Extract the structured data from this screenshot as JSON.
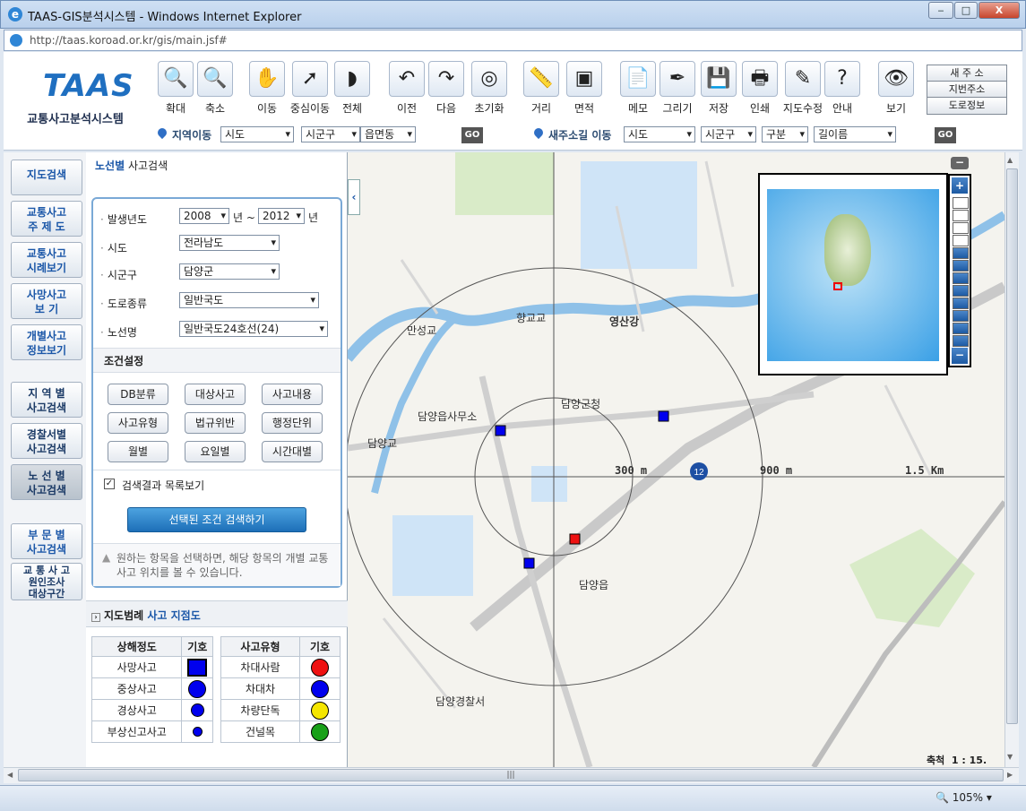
{
  "window": {
    "title": "TAAS-GIS분석시스템 - Windows Internet Explorer",
    "minimize": "‒",
    "maximize": "□",
    "close": "X"
  },
  "address": {
    "url": "http://taas.koroad.or.kr/gis/main.jsf#"
  },
  "logo": {
    "big": "TAAS",
    "sub": "교통사고분석시스템"
  },
  "toolbar": {
    "buttons": [
      {
        "label": "확대",
        "icon": "zoom-in-icon",
        "glyph": "🔍"
      },
      {
        "label": "축소",
        "icon": "zoom-out-icon",
        "glyph": "🔍"
      },
      {
        "label": "이동",
        "icon": "hand-icon",
        "glyph": "✋"
      },
      {
        "label": "중심이동",
        "icon": "center-move-icon",
        "glyph": "➚"
      },
      {
        "label": "전체",
        "icon": "full-extent-icon",
        "glyph": "◗"
      },
      {
        "label": "이전",
        "icon": "previous-icon",
        "glyph": "↶"
      },
      {
        "label": "다음",
        "icon": "next-icon",
        "glyph": "↷"
      },
      {
        "label": "초기화",
        "icon": "reset-icon",
        "glyph": "◎"
      },
      {
        "label": "거리",
        "icon": "ruler-icon",
        "glyph": "📏"
      },
      {
        "label": "면적",
        "icon": "area-icon",
        "glyph": "▣"
      },
      {
        "label": "메모",
        "icon": "memo-icon",
        "glyph": "📄"
      },
      {
        "label": "그리기",
        "icon": "pen-icon",
        "glyph": "✒"
      },
      {
        "label": "저장",
        "icon": "save-icon",
        "glyph": "💾"
      },
      {
        "label": "인쇄",
        "icon": "print-icon",
        "glyph": "🖶"
      },
      {
        "label": "지도수정",
        "icon": "edit-map-icon",
        "glyph": "✎"
      },
      {
        "label": "안내",
        "icon": "help-icon",
        "glyph": "?"
      },
      {
        "label": "보기",
        "icon": "eye-icon",
        "glyph": "👁"
      }
    ],
    "side": [
      "새 주 소",
      "지번주소",
      "도로정보"
    ],
    "region": {
      "label": "지역이동",
      "selects": [
        "시도",
        "시군구",
        "읍면동"
      ],
      "go": "GO"
    },
    "newaddr": {
      "label": "새주소길 이동",
      "selects": [
        "시도",
        "시군구",
        "구분",
        "길이름"
      ],
      "go": "GO"
    }
  },
  "nav": [
    {
      "label": "지도검색",
      "l2": ""
    },
    {
      "label": "교통사고",
      "l2": "주 제 도"
    },
    {
      "label": "교통사고",
      "l2": "시례보기"
    },
    {
      "label": "사망사고",
      "l2": "보    기"
    },
    {
      "label": "개별사고",
      "l2": "정보보기"
    },
    {
      "label": "지 역 별",
      "l2": "사고검색"
    },
    {
      "label": "경찰서별",
      "l2": "사고검색"
    },
    {
      "label": "노 선 별",
      "l2": "사고검색"
    },
    {
      "label": "부 문 별",
      "l2": "사고검색"
    },
    {
      "label": "교 통 사 고",
      "l2": "원인조사",
      "l3": "대상구간"
    }
  ],
  "panel": {
    "title_a": "노선별",
    "title_b": "사고검색",
    "year_label": "발생년도",
    "year_from": "2008",
    "year_sep": "년 ~",
    "year_to": "2012",
    "year_end": "년",
    "sido_label": "시도",
    "sido": "전라남도",
    "sigungu_label": "시군구",
    "sigungu": "담양군",
    "roadtype_label": "도로종류",
    "roadtype": "일반국도",
    "route_label": "노선명",
    "route": "일반국도24호선(24)",
    "cond_title": "조건설정",
    "cond_buttons": [
      "DB분류",
      "대상사고",
      "사고내용",
      "사고유형",
      "법규위반",
      "행정단위",
      "월별",
      "요일별",
      "시간대별"
    ],
    "checkbox": "검색결과 목록보기",
    "search_btn": "선택된 조건 검색하기",
    "hint": "원하는 항목을 선택하면, 해당 항목의 개별 교통사고 위치를 볼 수 있습니다."
  },
  "legend": {
    "title_a": "지도범례",
    "title_b": "사고 지점도",
    "h_severity": "상해정도",
    "h_symbol": "기호",
    "h_type": "사고유형",
    "h_symbol2": "기호",
    "severity": [
      "사망사고",
      "중상사고",
      "경상사고",
      "부상신고사고"
    ],
    "types": [
      "차대사람",
      "차대차",
      "차량단독",
      "건널목"
    ],
    "colors": {
      "blue": "#0000ee",
      "red": "#ee1111",
      "yellow": "#f5e600",
      "green": "#18a018"
    }
  },
  "map": {
    "labels": [
      "만성교",
      "향교교",
      "영산강",
      "담양읍사무소",
      "담양군청",
      "담양교",
      "담양읍",
      "담양경찰서"
    ],
    "rings": [
      "300 m",
      "900 m",
      "1.5 Km"
    ],
    "route_shield": "12",
    "scale_label": "축척",
    "scale_value": "1 : 15."
  },
  "status": {
    "zoom": "105%"
  }
}
